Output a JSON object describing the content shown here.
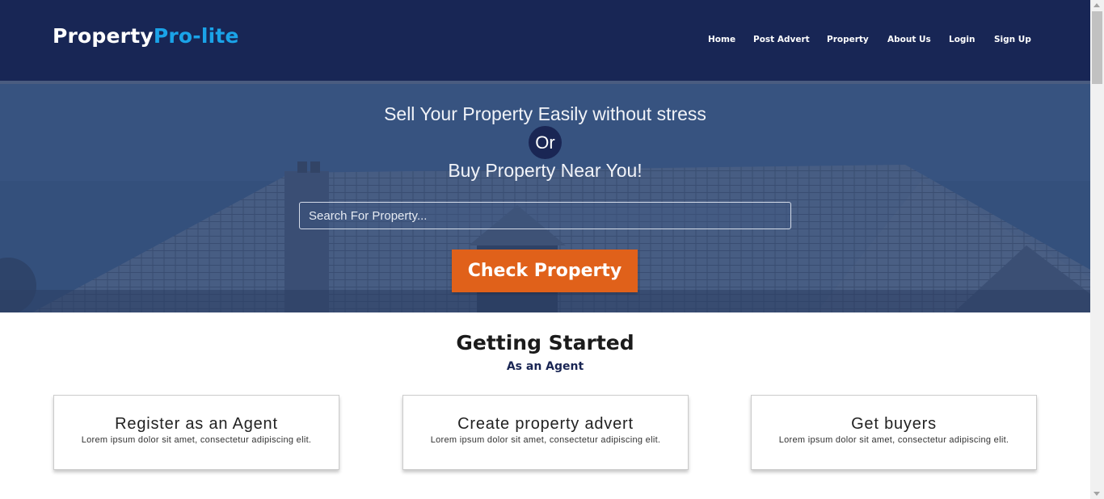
{
  "header": {
    "logo_part1": "Property",
    "logo_part2": "Pro-lite",
    "nav": {
      "home": "Home",
      "post_advert": "Post Advert",
      "property": "Property",
      "about_us": "About Us",
      "login": "Login",
      "sign_up": "Sign Up"
    }
  },
  "hero": {
    "line1": "Sell Your Property Easily without stress",
    "or": "Or",
    "line2": "Buy Property Near You!",
    "search_placeholder": "Search For Property...",
    "check_button": "Check Property"
  },
  "getting_started": {
    "title": "Getting Started",
    "subtitle": "As an Agent",
    "cards": [
      {
        "title": "Register as an Agent",
        "text": "Lorem ipsum dolor sit amet, consectetur adipiscing elit."
      },
      {
        "title": "Create property advert",
        "text": "Lorem ipsum dolor sit amet, consectetur adipiscing elit."
      },
      {
        "title": "Get buyers",
        "text": "Lorem ipsum dolor sit amet, consectetur adipiscing elit."
      }
    ]
  },
  "colors": {
    "header_bg": "#182655",
    "logo_accent": "#1aa3e8",
    "hero_overlay": "#34507c",
    "button": "#e0611a",
    "subtitle": "#1a2654"
  }
}
